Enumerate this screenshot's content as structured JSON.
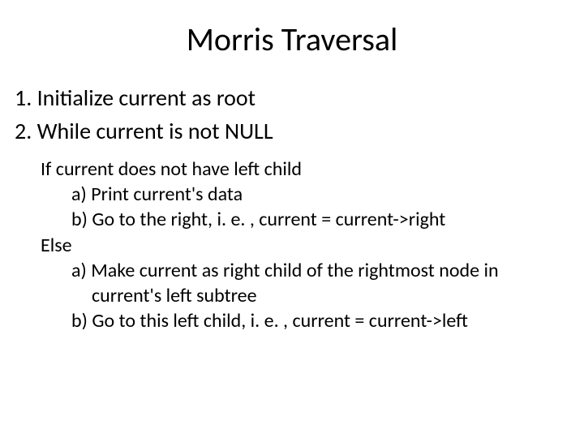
{
  "title": "Morris Traversal",
  "lines": {
    "step1": "1. Initialize current as root",
    "step2": "2. While current is not NULL",
    "if": "If current does not have left child",
    "if_a": "a) Print current's data",
    "if_b": "b) Go to the right, i. e. , current = current->right",
    "else": "Else",
    "else_a": "a) Make current as right child of the rightmost node in",
    "else_a_cont": "current's left subtree",
    "else_b": "b) Go to this left child, i. e. , current = current->left"
  }
}
